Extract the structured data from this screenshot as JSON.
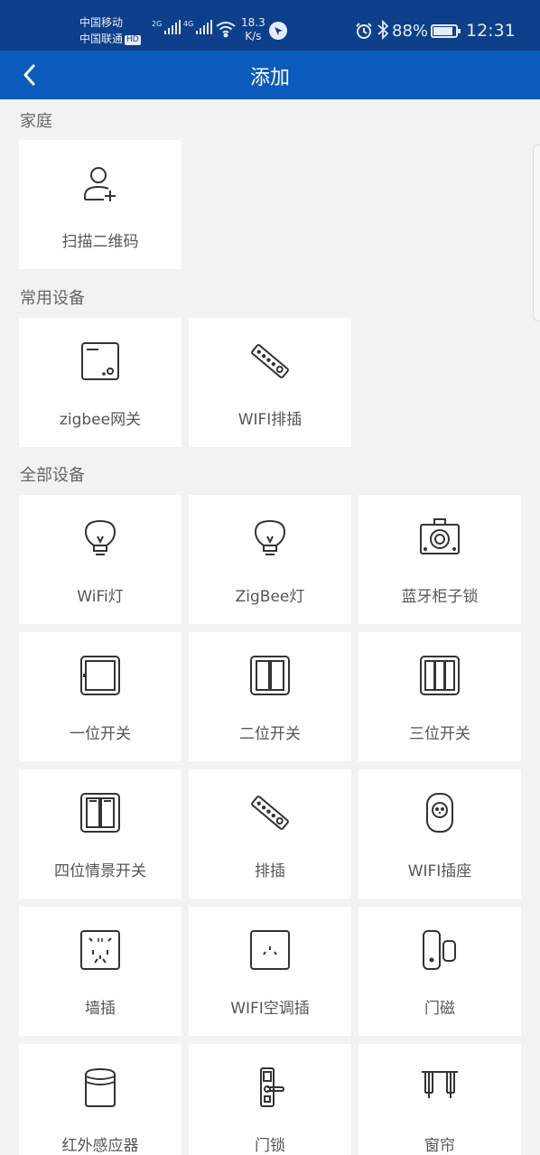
{
  "status_bar": {
    "carrier1": "中国移动",
    "carrier2": "中国联通",
    "hd": "HD",
    "net1": "2G",
    "net2": "4G",
    "speed_value": "18.3",
    "speed_unit": "K/s",
    "battery_text": "88%",
    "battery_level": 0.88,
    "time": "12:31"
  },
  "header": {
    "title": "添加"
  },
  "sections": {
    "home": {
      "label": "家庭",
      "items": [
        {
          "label": "扫描二维码",
          "icon": "add-user-icon"
        }
      ]
    },
    "common": {
      "label": "常用设备",
      "items": [
        {
          "label": "zigbee网关",
          "icon": "gateway-icon"
        },
        {
          "label": "WIFI排插",
          "icon": "power-strip-icon"
        }
      ]
    },
    "all": {
      "label": "全部设备",
      "items": [
        {
          "label": "WiFi灯",
          "icon": "bulb-icon"
        },
        {
          "label": "ZigBee灯",
          "icon": "bulb-icon"
        },
        {
          "label": "蓝牙柜子锁",
          "icon": "cabinet-lock-icon"
        },
        {
          "label": "一位开关",
          "icon": "switch-1-icon"
        },
        {
          "label": "二位开关",
          "icon": "switch-2-icon"
        },
        {
          "label": "三位开关",
          "icon": "switch-3-icon"
        },
        {
          "label": "四位情景开关",
          "icon": "scene-switch-icon"
        },
        {
          "label": "排插",
          "icon": "power-strip-icon"
        },
        {
          "label": "WIFI插座",
          "icon": "smart-plug-icon"
        },
        {
          "label": "墙插",
          "icon": "wall-socket-icon"
        },
        {
          "label": "WIFI空调插",
          "icon": "ac-socket-icon"
        },
        {
          "label": "门磁",
          "icon": "door-sensor-icon"
        },
        {
          "label": "红外感应器",
          "icon": "pir-sensor-icon"
        },
        {
          "label": "门锁",
          "icon": "door-lock-icon"
        },
        {
          "label": "窗帘",
          "icon": "curtain-icon"
        }
      ]
    }
  },
  "colors": {
    "status_bar": "#0d3f8a",
    "nav_bar": "#0a5bbb",
    "background": "#f2f2f2",
    "card": "#ffffff",
    "icon_stroke": "#333333",
    "label": "#555555"
  }
}
